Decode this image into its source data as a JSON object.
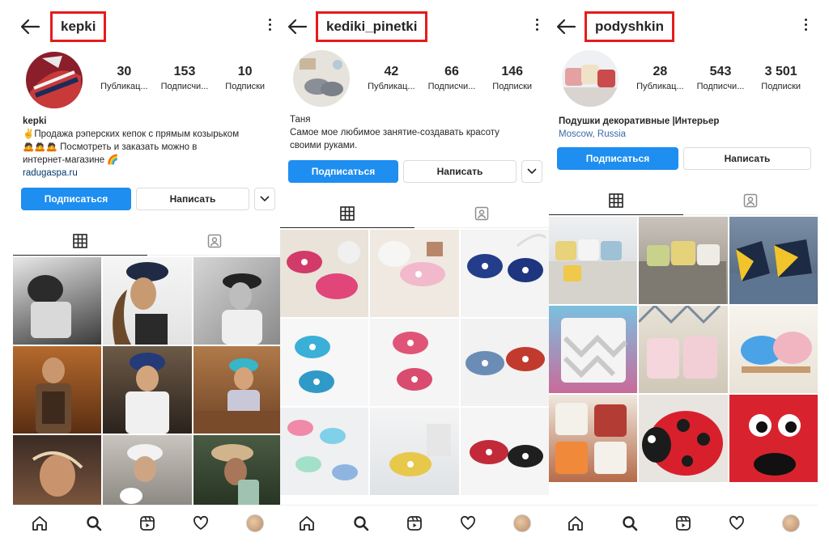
{
  "profiles": [
    {
      "username": "kepki",
      "stats": [
        {
          "value": "30",
          "label": "Публикац..."
        },
        {
          "value": "153",
          "label": "Подписчи..."
        },
        {
          "value": "10",
          "label": "Подписки"
        }
      ],
      "bio_name": "kepki",
      "bio_lines": [
        "✌️Продажа рэперских кепок с прямым козырьком",
        "🙇🙇🙇 Посмотреть и заказать можно в",
        "интернет-магазине 🌈"
      ],
      "bio_link": "radugaspa.ru",
      "follow_label": "Подписаться",
      "message_label": "Написать"
    },
    {
      "username": "kediki_pinetki",
      "stats": [
        {
          "value": "42",
          "label": "Публикац..."
        },
        {
          "value": "66",
          "label": "Подписчи..."
        },
        {
          "value": "146",
          "label": "Подписки"
        }
      ],
      "bio_name": "Таня",
      "bio_lines": [
        "Самое мое любимое занятие-создавать красоту",
        "своими руками."
      ],
      "bio_link": "",
      "follow_label": "Подписаться",
      "message_label": "Написать"
    },
    {
      "username": "podyshkin",
      "stats": [
        {
          "value": "28",
          "label": "Публикац..."
        },
        {
          "value": "543",
          "label": "Подписчи..."
        },
        {
          "value": "3 501",
          "label": "Подписки"
        }
      ],
      "bio_name": "Подушки декоративные |Интерьер",
      "bio_lines": [],
      "bio_link": "Moscow, Russia",
      "follow_label": "Подписаться",
      "message_label": "Написать"
    }
  ],
  "colors": {
    "highlight_border": "#e41c1c",
    "follow_button": "#1e8ef0",
    "link": "#00376b"
  },
  "icons": [
    "back-arrow-icon",
    "more-vertical-icon",
    "grid-icon",
    "tagged-icon",
    "home-icon",
    "search-icon",
    "reels-icon",
    "heart-icon",
    "chevron-down-icon"
  ]
}
